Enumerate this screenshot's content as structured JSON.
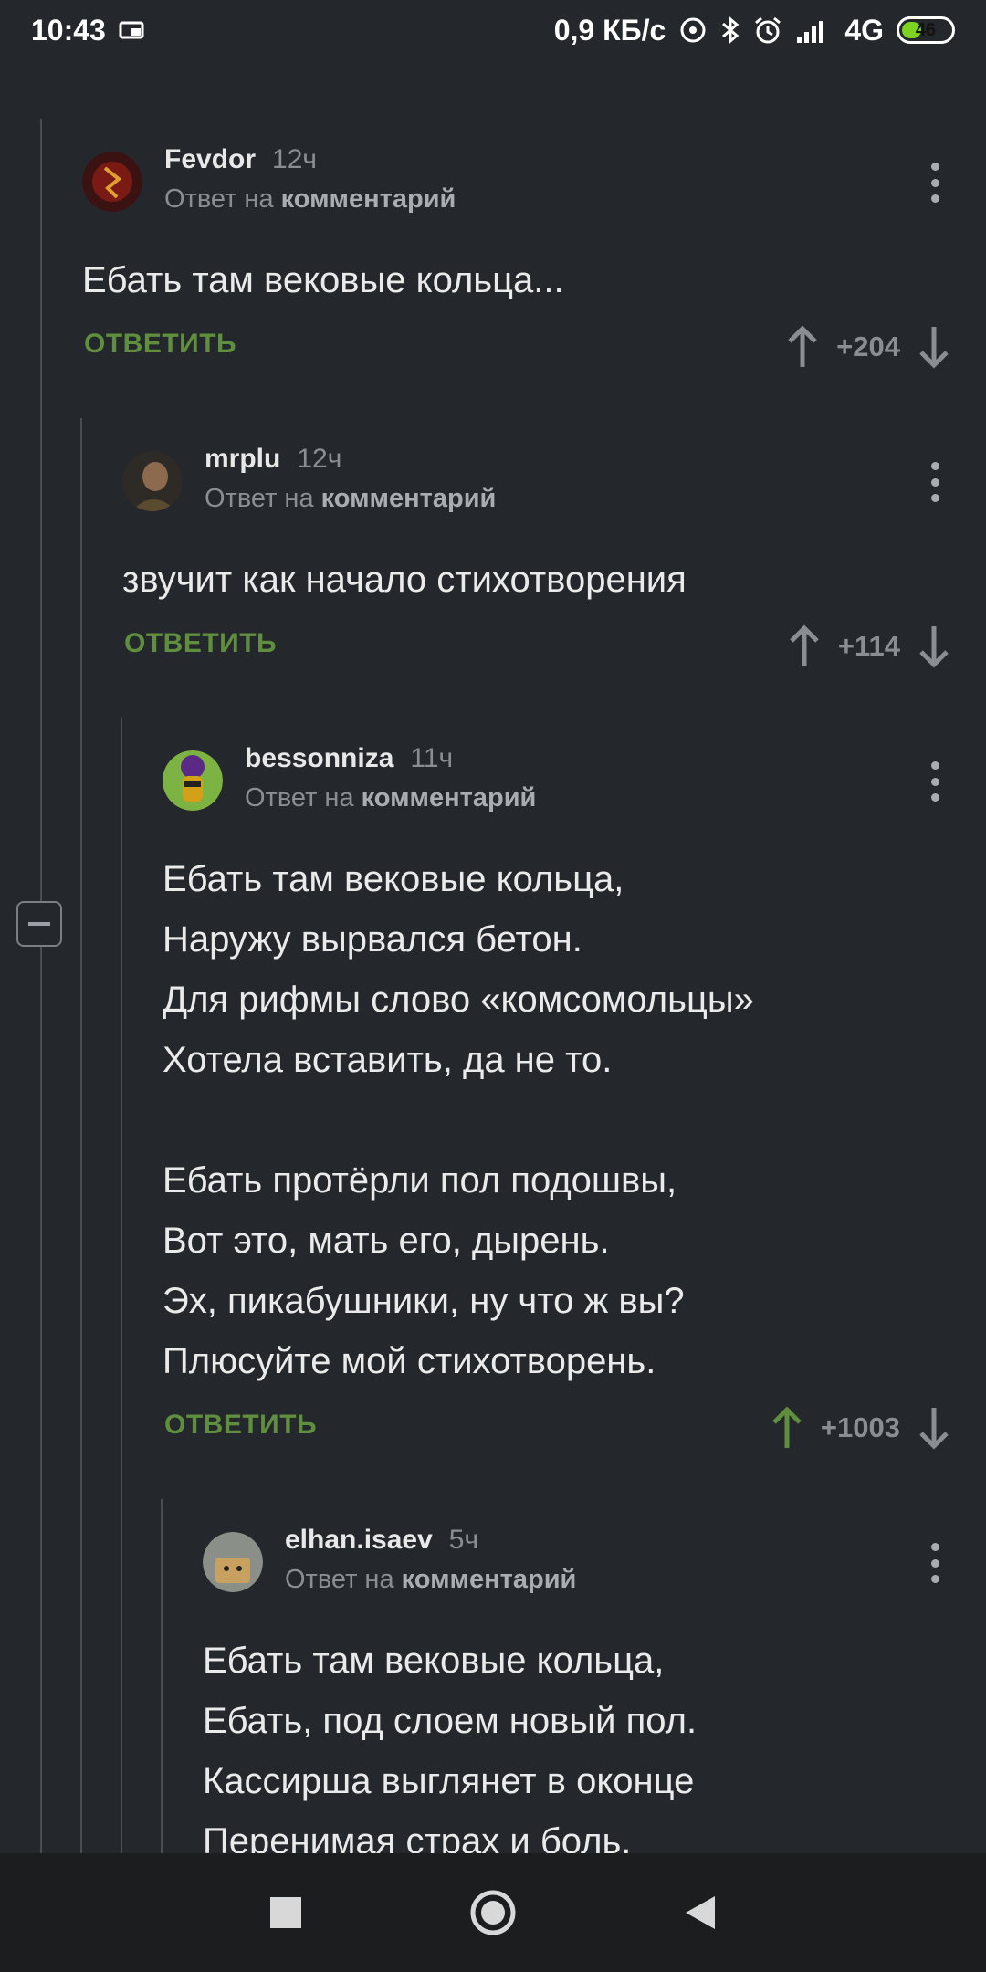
{
  "status_bar": {
    "time": "10:43",
    "net_speed": "0,9 КБ/с",
    "network": "4G",
    "battery": "46",
    "battery_level": 0.46
  },
  "reply_to_prefix": "Ответ на",
  "reply_to_target": "комментарий",
  "reply_label": "ОТВЕТИТЬ",
  "comments": [
    {
      "author": "Fevdor",
      "time": "12ч",
      "body": "Ебать там вековые кольца...",
      "rating": "+204",
      "upvoted": false
    },
    {
      "author": "mrplu",
      "time": "12ч",
      "body": "звучит как начало стихотворения",
      "rating": "+114",
      "upvoted": false
    },
    {
      "author": "bessonniza",
      "time": "11ч",
      "body": "Ебать там вековые кольца,\nНаружу вырвался бетон.\nДля рифмы слово «комсомольцы»\nХотела вставить, да не то.\n\nЕбать протёрли пол подошвы,\nВот это, мать его, дырень.\nЭх, пикабушники, ну что ж вы?\nПлюсуйте мой стихотворень.",
      "rating": "+1003",
      "upvoted": true
    },
    {
      "author": "elhan.isaev",
      "time": "5ч",
      "body": "Ебать там вековые кольца,\nЕбать, под слоем новый пол.\nКассирша выглянет в оконце\nПеренимая страх и боль."
    }
  ],
  "colors": {
    "background": "#24272b",
    "accent_green": "#5e8e3e",
    "muted": "#8a8e93"
  }
}
